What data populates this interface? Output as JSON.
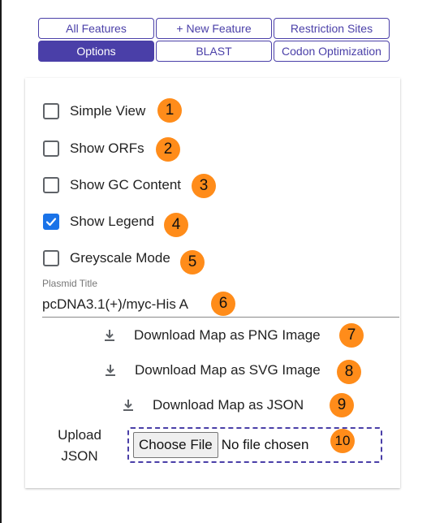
{
  "tabs": {
    "row1": [
      "All Features",
      "+ New Feature",
      "Restriction Sites"
    ],
    "row2": [
      "Options",
      "BLAST",
      "Codon Optimization"
    ],
    "active": "Options"
  },
  "options": [
    {
      "label": "Simple View",
      "checked": false,
      "badge": "1"
    },
    {
      "label": "Show ORFs",
      "checked": false,
      "badge": "2"
    },
    {
      "label": "Show GC Content",
      "checked": false,
      "badge": "3"
    },
    {
      "label": "Show Legend",
      "checked": true,
      "badge": "4"
    },
    {
      "label": "Greyscale Mode",
      "checked": false,
      "badge": "5"
    }
  ],
  "plasmid_title": {
    "label": "Plasmid Title",
    "value": "pcDNA3.1(+)/myc-His A",
    "badge": "6"
  },
  "downloads": [
    {
      "label": "Download Map as PNG Image",
      "badge": "7",
      "icon": "download-icon"
    },
    {
      "label": "Download Map as SVG Image",
      "badge": "8",
      "icon": "download-icon"
    },
    {
      "label": "Download Map as JSON",
      "badge": "9",
      "icon": "download-icon"
    }
  ],
  "upload": {
    "label_line1": "Upload",
    "label_line2": "JSON",
    "button": "Choose File",
    "status": "No file chosen",
    "badge": "10"
  },
  "colors": {
    "accent": "#4a3fa8",
    "checkbox_checked": "#1a73e8",
    "badge": "#ff8c1a"
  }
}
